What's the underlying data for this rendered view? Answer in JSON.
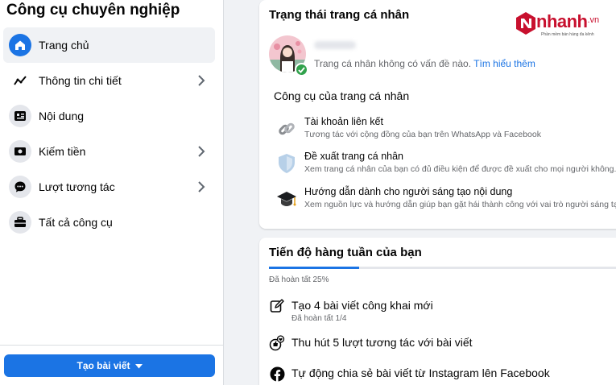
{
  "sidebar": {
    "title": "Công cụ chuyên nghiệp",
    "items": [
      {
        "label": "Trang chủ",
        "icon": "home-icon",
        "active": true,
        "has_chevron": false
      },
      {
        "label": "Thông tin chi tiết",
        "icon": "insights-icon",
        "active": false,
        "has_chevron": true
      },
      {
        "label": "Nội dung",
        "icon": "content-icon",
        "active": false,
        "has_chevron": false
      },
      {
        "label": "Kiếm tiền",
        "icon": "money-icon",
        "active": false,
        "has_chevron": true
      },
      {
        "label": "Lượt tương tác",
        "icon": "chat-icon",
        "active": false,
        "has_chevron": true
      },
      {
        "label": "Tất cả công cụ",
        "icon": "toolbox-icon",
        "active": false,
        "has_chevron": false
      }
    ],
    "create_post_label": "Tạo bài viết"
  },
  "profile_status_card": {
    "title": "Trạng thái trang cá nhân",
    "status_text": "Trang cá nhân không có vấn đề nào.",
    "learn_more_label": "Tìm hiểu thêm",
    "tools_section_title": "Công cụ của trang cá nhân",
    "tools": [
      {
        "title": "Tài khoản liên kết",
        "description": "Tương tác với cộng đồng của bạn trên WhatsApp và Facebook",
        "icon": "link-icon"
      },
      {
        "title": "Đề xuất trang cá nhân",
        "description": "Xem trang cá nhân của bạn có đủ điều kiện để được đề xuất cho mọi người không.",
        "icon": "shield-icon"
      },
      {
        "title": "Hướng dẫn dành cho người sáng tạo nội dung",
        "description": "Xem nguồn lực và hướng dẫn giúp bạn gặt hái thành công với vai trò người sáng tạo n",
        "icon": "graduation-cap-icon"
      }
    ]
  },
  "logo": {
    "text": "nhanh",
    "suffix": ".vn",
    "tagline": "Phần mềm bán hàng đa kênh"
  },
  "weekly_progress_card": {
    "title": "Tiến độ hàng tuần của bạn",
    "progress_percent": 25,
    "progress_text": "Đã hoàn tất 25%",
    "tasks": [
      {
        "title": "Tạo 4 bài viết công khai mới",
        "subtitle": "Đã hoàn tất 1/4",
        "icon": "edit-icon"
      },
      {
        "title": "Thu hút 5 lượt tương tác với bài viết",
        "subtitle": "",
        "icon": "reactions-icon"
      },
      {
        "title": "Tự động chia sẻ bài viết từ Instagram lên Facebook",
        "subtitle": "",
        "icon": "facebook-icon"
      }
    ]
  },
  "colors": {
    "accent": "#1b74e4",
    "success": "#31a24c",
    "brand_red": "#c8102e"
  }
}
